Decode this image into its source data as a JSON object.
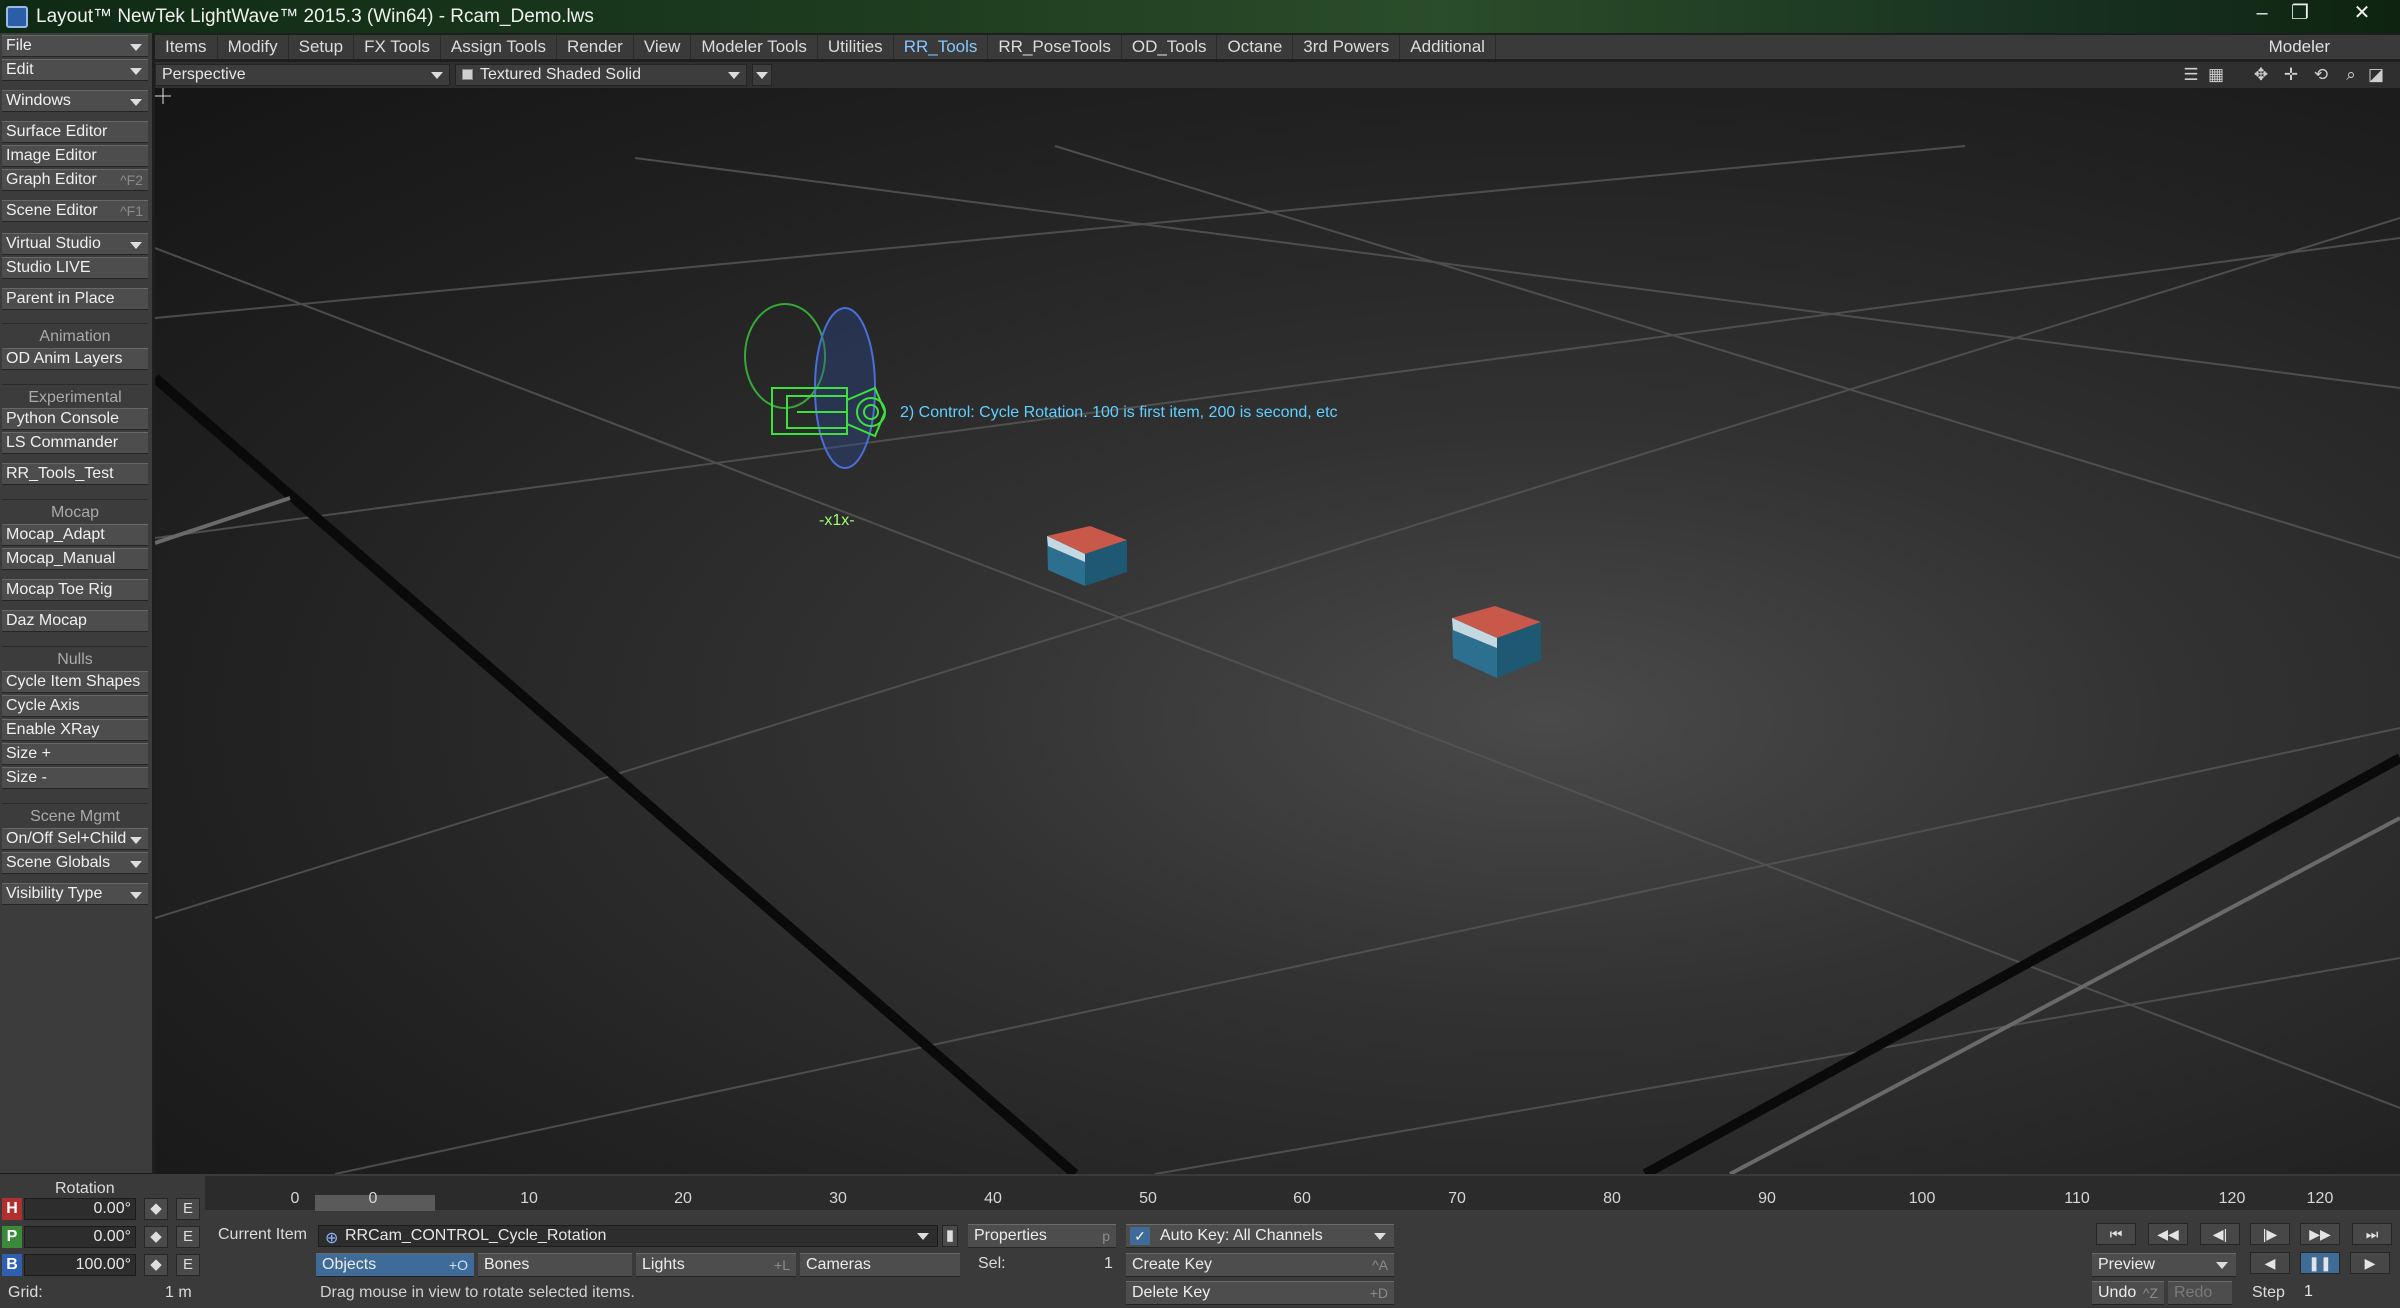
{
  "window": {
    "title": "Layout™ NewTek LightWave™ 2015.3 (Win64) - Rcam_Demo.lws"
  },
  "menubar": {
    "file": "File",
    "edit": "Edit",
    "tabs": [
      "Items",
      "Modify",
      "Setup",
      "FX Tools",
      "Assign Tools",
      "Render",
      "View",
      "Modeler Tools",
      "Utilities",
      "RR_Tools",
      "RR_PoseTools",
      "OD_Tools",
      "Octane",
      "3rd Powers",
      "Additional"
    ],
    "active_tab": "RR_Tools",
    "modeler": "Modeler"
  },
  "sidebar": {
    "windows": "Windows",
    "surface_editor": "Surface Editor",
    "image_editor": "Image Editor",
    "graph_editor": "Graph Editor",
    "graph_editor_sc": "^F2",
    "scene_editor": "Scene Editor",
    "scene_editor_sc": "^F1",
    "virtual_studio": "Virtual Studio",
    "studio_live": "Studio LIVE",
    "parent_in_place": "Parent in Place",
    "animation_header": "Animation",
    "od_anim_layers": "OD Anim Layers",
    "experimental_header": "Experimental",
    "python_console": "Python Console",
    "ls_commander": "LS Commander",
    "rr_tools_test": "RR_Tools_Test",
    "mocap_header": "Mocap",
    "mocap_adapt": "Mocap_Adapt",
    "mocap_manual": "Mocap_Manual",
    "mocap_toe_rig": "Mocap Toe Rig",
    "daz_mocap": "Daz Mocap",
    "nulls_header": "Nulls",
    "cycle_item_shapes": "Cycle Item Shapes",
    "cycle_axis": "Cycle Axis",
    "enable_xray": "Enable XRay",
    "size_plus": "Size +",
    "size_minus": "Size -",
    "scene_mgmt_header": "Scene Mgmt",
    "on_off_sel_child": "On/Off Sel+Child",
    "scene_globals": "Scene Globals",
    "visibility_type": "Visibility Type"
  },
  "viewport": {
    "view_mode": "Perspective",
    "render_mode": "Textured Shaded Solid",
    "annotation": "2) Control: Cycle Rotation. 100 is first item, 200 is second, etc",
    "null_label": "-x1x-",
    "colors": {
      "annotation": "#5fd0ff",
      "camera_wire": "#3ee03e",
      "cube_top": "#c8584a",
      "cube_side": "#2a6f8c"
    }
  },
  "timeline": {
    "ticks": [
      "0",
      "0",
      "10",
      "20",
      "30",
      "40",
      "50",
      "60",
      "70",
      "80",
      "90",
      "100",
      "110",
      "120",
      "120"
    ]
  },
  "rotation_panel": {
    "title": "Rotation",
    "channels": [
      {
        "name": "H",
        "value": "0.00°",
        "color": "#b03030"
      },
      {
        "name": "P",
        "value": "0.00°",
        "color": "#3a8a3a"
      },
      {
        "name": "B",
        "value": "100.00°",
        "color": "#2e5fb0"
      }
    ],
    "e_label": "E",
    "grid_label": "Grid:",
    "grid_value": "1 m"
  },
  "item_panel": {
    "current_item_label": "Current Item",
    "current_item": "RRCam_CONTROL_Cycle_Rotation",
    "properties": "Properties",
    "properties_sc": "p",
    "objects": "Objects",
    "objects_sc": "+O",
    "bones": "Bones",
    "lights": "Lights",
    "lights_sc": "+L",
    "cameras": "Cameras",
    "sel_label": "Sel:",
    "sel_value": "1",
    "status": "Drag mouse in view to rotate selected items."
  },
  "key_panel": {
    "auto_key": "Auto Key: All Channels",
    "create_key": "Create Key",
    "create_key_sc": "^A",
    "delete_key": "Delete Key",
    "delete_key_sc": "+D"
  },
  "playback": {
    "preview": "Preview",
    "undo": "Undo",
    "undo_sc": "^Z",
    "redo": "Redo",
    "step_label": "Step",
    "step_value": "1"
  }
}
